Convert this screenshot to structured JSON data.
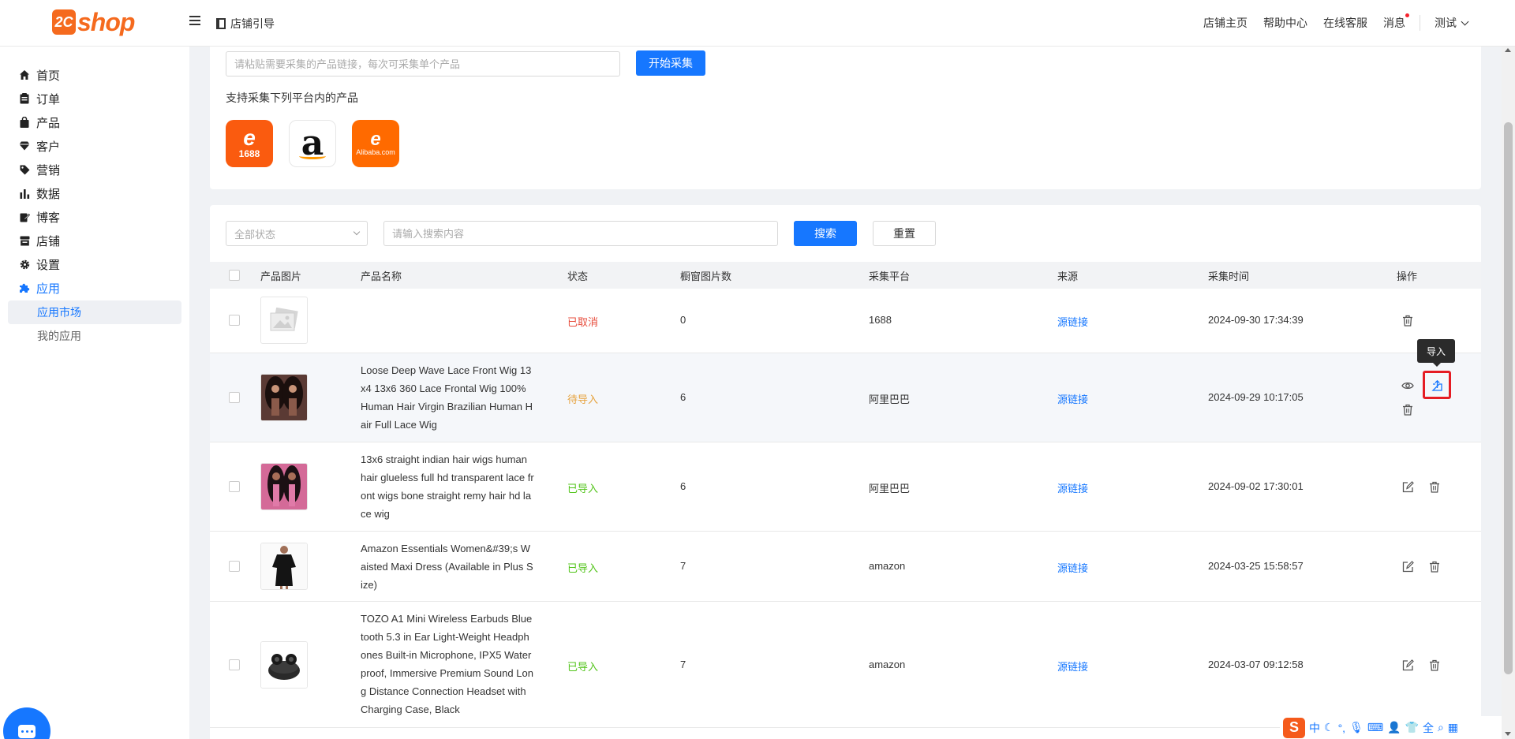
{
  "header": {
    "logo_mark": "2C",
    "logo_text": "shop",
    "guide_label": "店铺引导",
    "nav": [
      "店铺主页",
      "帮助中心",
      "在线客服",
      "消息"
    ],
    "user": "测试"
  },
  "sidebar": {
    "items": [
      {
        "label": "首页",
        "icon": "home-icon"
      },
      {
        "label": "订单",
        "icon": "clipboard-icon"
      },
      {
        "label": "产品",
        "icon": "bag-icon"
      },
      {
        "label": "客户",
        "icon": "diamond-icon"
      },
      {
        "label": "营销",
        "icon": "tag-icon"
      },
      {
        "label": "数据",
        "icon": "bar-chart-icon"
      },
      {
        "label": "博客",
        "icon": "edit-icon"
      },
      {
        "label": "店铺",
        "icon": "store-icon"
      },
      {
        "label": "设置",
        "icon": "gear-icon"
      },
      {
        "label": "应用",
        "icon": "puzzle-icon"
      }
    ],
    "sub_items": [
      "应用市场",
      "我的应用"
    ]
  },
  "collect": {
    "url_placeholder": "请粘贴需要采集的产品链接，每次可采集单个产品",
    "start_button": "开始采集",
    "support_text": "支持采集下列平台内的产品",
    "platforms": [
      {
        "name": "1688",
        "symbol": "e",
        "label": "1688"
      },
      {
        "name": "amazon",
        "symbol": "a",
        "label": ""
      },
      {
        "name": "alibaba",
        "symbol": "e",
        "label": "Alibaba.com"
      }
    ]
  },
  "filters": {
    "status_placeholder": "全部状态",
    "search_placeholder": "请输入搜索内容",
    "search_button": "搜索",
    "reset_button": "重置"
  },
  "table": {
    "columns": [
      "产品图片",
      "产品名称",
      "状态",
      "橱窗图片数",
      "采集平台",
      "来源",
      "采集时间",
      "操作"
    ],
    "rows": [
      {
        "name": "",
        "status": "已取消",
        "status_type": "cancel",
        "images": "0",
        "platform": "1688",
        "source": "源链接",
        "time": "2024-09-30 17:34:39",
        "ops": [
          "delete"
        ]
      },
      {
        "name": "Loose Deep Wave Lace Front Wig 13x4 13x6 360 Lace Frontal Wig 100% Human Hair Virgin Brazilian Human Hair Full Lace Wig",
        "status": "待导入",
        "status_type": "pending",
        "images": "6",
        "platform": "阿里巴巴",
        "source": "源链接",
        "time": "2024-09-29 10:17:05",
        "ops": [
          "view",
          "import",
          "delete"
        ]
      },
      {
        "name": "13x6 straight indian hair wigs human hair glueless full hd transparent lace front wigs bone straight remy hair hd lace wig",
        "status": "已导入",
        "status_type": "done",
        "images": "6",
        "platform": "阿里巴巴",
        "source": "源链接",
        "time": "2024-09-02 17:30:01",
        "ops": [
          "edit",
          "delete"
        ]
      },
      {
        "name": "Amazon Essentials Women&#39;s Waisted Maxi Dress (Available in Plus Size)",
        "status": "已导入",
        "status_type": "done",
        "images": "7",
        "platform": "amazon",
        "source": "源链接",
        "time": "2024-03-25 15:58:57",
        "ops": [
          "edit",
          "delete"
        ]
      },
      {
        "name": "TOZO A1 Mini Wireless Earbuds Bluetooth 5.3 in Ear Light-Weight Headphones Built-in Microphone, IPX5 Waterproof, Immersive Premium Sound Long Distance Connection Headset with Charging Case, Black",
        "status": "已导入",
        "status_type": "done",
        "images": "7",
        "platform": "amazon",
        "source": "源链接",
        "time": "2024-03-07 09:12:58",
        "ops": [
          "edit",
          "delete"
        ]
      }
    ]
  },
  "tooltip": "导入",
  "ime": {
    "logo": "S",
    "mode": "中"
  },
  "colors": {
    "primary": "#1677ff",
    "brand": "#f56a1e",
    "cancel": "#e74c3c",
    "pending": "#e6a23c",
    "done": "#52c41a",
    "highlight": "#e51c23"
  }
}
